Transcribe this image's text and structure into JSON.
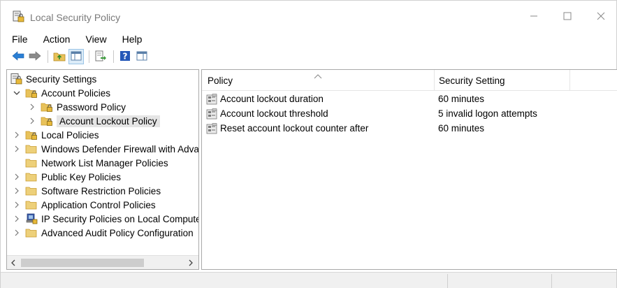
{
  "window": {
    "title": "Local Security Policy",
    "icon": "security-policy-icon",
    "controls": [
      "minimize-icon",
      "maximize-icon",
      "close-icon"
    ]
  },
  "menu": {
    "items": [
      "File",
      "Action",
      "View",
      "Help"
    ]
  },
  "toolbar": {
    "buttons": [
      "back-arrow-icon",
      "forward-arrow-icon",
      "up-folder-icon",
      "show-hide-tree-icon",
      "export-list-icon",
      "help-icon",
      "show-action-pane-icon"
    ]
  },
  "tree": {
    "root": "Security Settings",
    "items": [
      {
        "label": "Account Policies",
        "level": 1,
        "expander": "expanded",
        "icon": "folder-lock-icon"
      },
      {
        "label": "Password Policy",
        "level": 2,
        "expander": "collapsed",
        "icon": "folder-lock-icon"
      },
      {
        "label": "Account Lockout Policy",
        "level": 2,
        "expander": "collapsed",
        "icon": "folder-lock-icon",
        "selected": true
      },
      {
        "label": "Local Policies",
        "level": 1,
        "expander": "collapsed",
        "icon": "folder-lock-icon"
      },
      {
        "label": "Windows Defender Firewall with Adva",
        "level": 1,
        "expander": "collapsed",
        "icon": "folder-icon"
      },
      {
        "label": "Network List Manager Policies",
        "level": 1,
        "expander": "none",
        "icon": "folder-icon"
      },
      {
        "label": "Public Key Policies",
        "level": 1,
        "expander": "collapsed",
        "icon": "folder-icon"
      },
      {
        "label": "Software Restriction Policies",
        "level": 1,
        "expander": "collapsed",
        "icon": "folder-icon"
      },
      {
        "label": "Application Control Policies",
        "level": 1,
        "expander": "collapsed",
        "icon": "folder-icon"
      },
      {
        "label": "IP Security Policies on Local Compute",
        "level": 1,
        "expander": "collapsed",
        "icon": "ip-security-icon"
      },
      {
        "label": "Advanced Audit Policy Configuration",
        "level": 1,
        "expander": "collapsed",
        "icon": "folder-icon"
      }
    ]
  },
  "list": {
    "columns": {
      "policy": "Policy",
      "setting": "Security Setting"
    },
    "rows": [
      {
        "policy": "Account lockout duration",
        "setting": "60 minutes"
      },
      {
        "policy": "Account lockout threshold",
        "setting": "5 invalid logon attempts"
      },
      {
        "policy": "Reset account lockout counter after",
        "setting": "60 minutes"
      }
    ]
  },
  "colors": {
    "folder": "#e8c25a",
    "folder_dark": "#c99a2e",
    "arrow_blue": "#2a7fd4",
    "help_blue": "#2457b8",
    "selection": "#e5e5e5"
  }
}
